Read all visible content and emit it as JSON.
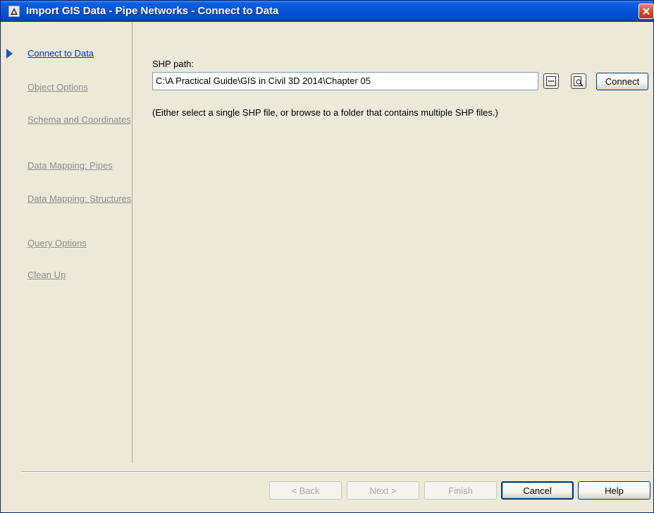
{
  "window": {
    "title": "Import GIS Data - Pipe Networks - Connect to Data"
  },
  "nav": {
    "items": [
      {
        "label": "Connect to Data",
        "active": true
      },
      {
        "label": "Object Options",
        "active": false
      },
      {
        "label": "Schema and Coordinates",
        "active": false
      },
      {
        "label": "Data Mapping: Pipes",
        "active": false
      },
      {
        "label": "Data Mapping: Structures",
        "active": false
      },
      {
        "label": "Query Options",
        "active": false
      },
      {
        "label": "Clean Up",
        "active": false
      }
    ]
  },
  "main": {
    "shp_path_label": "SHP path:",
    "shp_path_value": "C:\\A Practical Guide\\GIS in Civil 3D 2014\\Chapter 05",
    "browse_icon": "ellipsis-icon",
    "preview_icon": "preview-icon",
    "connect_label": "Connect",
    "hint": "(Either select a single SHP file, or browse to a folder that contains multiple SHP files.)"
  },
  "footer": {
    "back_label": "< Back",
    "next_label": "Next >",
    "finish_label": "Finish",
    "cancel_label": "Cancel",
    "help_label": "Help"
  },
  "colors": {
    "titlebar": "#0654d6",
    "active_link": "#0033cc",
    "inactive_link": "#8c8c8c",
    "nav_arrow": "#1a55c8",
    "close_button": "#d2421c"
  }
}
